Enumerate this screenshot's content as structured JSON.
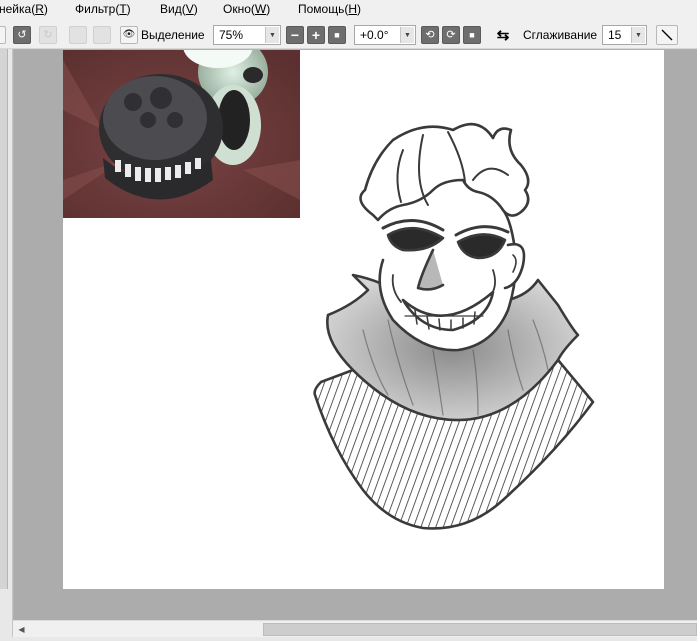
{
  "menubar": {
    "items": [
      {
        "prefix": "нейка(",
        "key": "R",
        "suffix": ")"
      },
      {
        "prefix": "Фильтр(",
        "key": "T",
        "suffix": ")"
      },
      {
        "prefix": "Вид(",
        "key": "V",
        "suffix": ")"
      },
      {
        "prefix": "Окно(",
        "key": "W",
        "suffix": ")"
      },
      {
        "prefix": "Помощь(",
        "key": "H",
        "suffix": ")"
      }
    ]
  },
  "toolbar": {
    "selection_label": "Выделение",
    "zoom_value": "75%",
    "rotation_value": "+0.0°",
    "smoothing_label": "Сглаживание",
    "smoothing_value": "15",
    "icons": {
      "undo": "↺",
      "redo": "↻",
      "eye": "👁",
      "zoom_out": "−",
      "zoom_in": "+",
      "zoom_reset": "■",
      "rotate_left": "⟲",
      "rotate_right": "⟳",
      "rotate_reset": "■",
      "flip": "⇆",
      "combo_arrow": "▼",
      "scroll_left": "◀"
    }
  },
  "colors": {
    "canvas_bg": "#acacac",
    "paper": "#ffffff",
    "ref_bg": "#6b3a3a",
    "accent_border": "#f0a060"
  }
}
